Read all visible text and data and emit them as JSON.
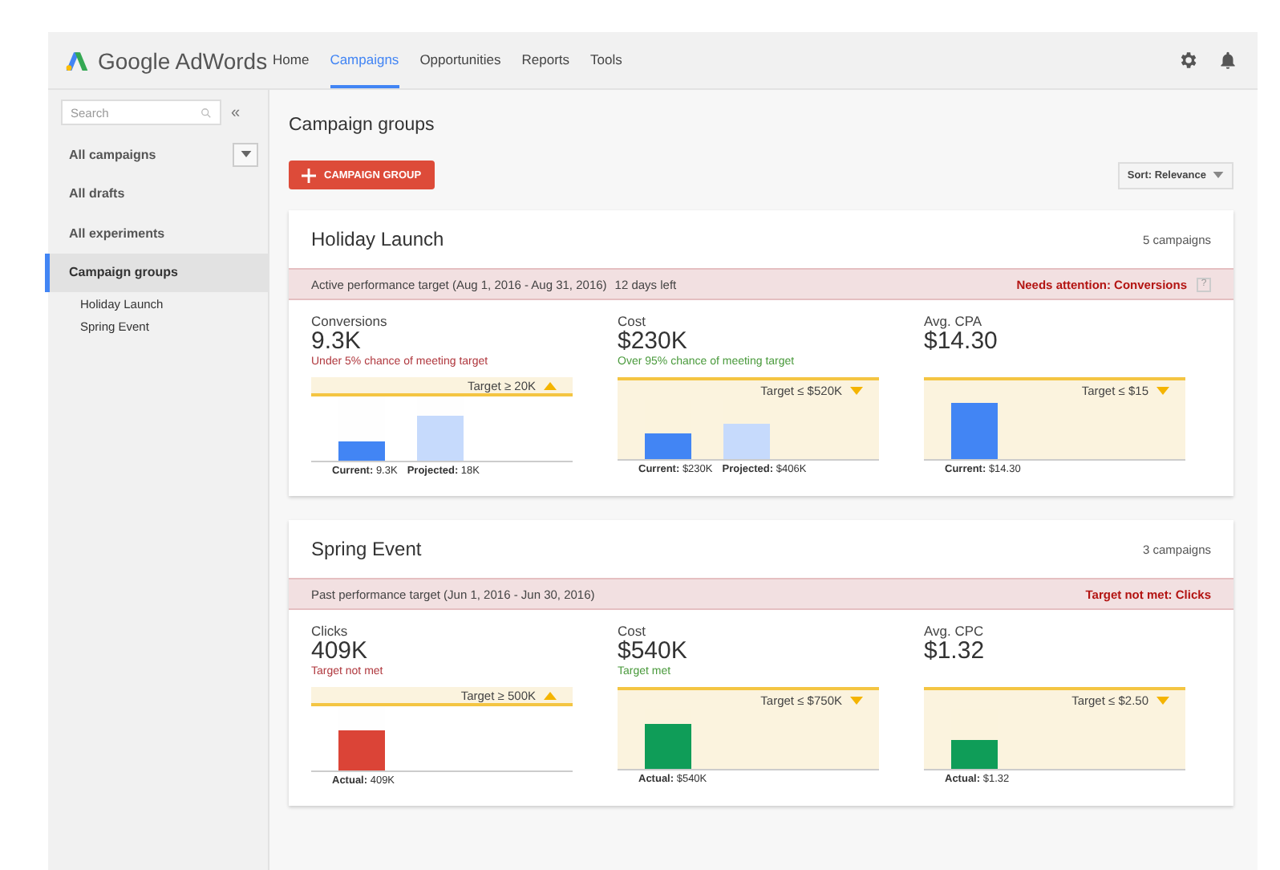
{
  "header": {
    "logo": "Google AdWords",
    "nav": [
      {
        "label": "Home",
        "selected": false
      },
      {
        "label": "Campaigns",
        "selected": true
      },
      {
        "label": "Opportunities",
        "selected": false
      },
      {
        "label": "Reports",
        "selected": false
      },
      {
        "label": "Tools",
        "selected": false
      }
    ]
  },
  "sidebar": {
    "search": {
      "placeholder": "Search"
    },
    "collapse": "«",
    "items": [
      {
        "label": "All campaigns",
        "selected": false,
        "dropdown": true
      },
      {
        "label": "All drafts",
        "selected": false,
        "dropdown": false
      },
      {
        "label": "All experiments",
        "selected": false,
        "dropdown": false
      },
      {
        "label": "Campaign groups",
        "selected": true,
        "dropdown": false,
        "children": [
          {
            "label": "Holiday Launch"
          },
          {
            "label": "Spring Event"
          }
        ]
      }
    ]
  },
  "page": {
    "title": "Campaign groups",
    "add_button": "CAMPAIGN GROUP",
    "sort": "Sort: Relevance"
  },
  "groups": [
    {
      "name": "Holiday Launch",
      "count": "5 campaigns",
      "target": "Active performance target (Aug 1, 2016 - Aug 31, 2016)",
      "remaining": "12 days left",
      "alert": "Needs attention: Conversions",
      "help": "?",
      "metrics": [
        {
          "label": "Conversions",
          "value": "9.3K",
          "status": "Under 5% chance of meeting target",
          "on_track": false,
          "kind": "min",
          "target": "Target ≥ 20K",
          "bars": [
            {
              "level": 0.3,
              "color": "#4285f4",
              "label": "**Current:** 9.3K"
            },
            {
              "level": 0.7,
              "color": "#c6dafc",
              "label": "**Projected:** 18K"
            }
          ]
        },
        {
          "label": "Cost",
          "value": "$230K",
          "status": "Over 95% chance of meeting target",
          "on_track": true,
          "kind": "max",
          "target": "Target ≤ $520K",
          "bars": [
            {
              "level": 0.42,
              "color": "#4285f4",
              "label": "**Current:** $230K"
            },
            {
              "level": 0.6,
              "color": "#c6dafc",
              "label": "**Projected:** $406K"
            }
          ]
        },
        {
          "label": "Avg. CPA",
          "value": "$14.30",
          "kind": "max",
          "target": "Target ≤ $15",
          "bars": [
            {
              "level": 0.95,
              "color": "#4285f4",
              "label": "**Current:** $14.30"
            }
          ]
        }
      ]
    },
    {
      "name": "Spring Event",
      "count": "3 campaigns",
      "target": "Past performance target (Jun 1, 2016 - Jun 30, 2016)",
      "alert": "Target not met: Clicks",
      "metrics": [
        {
          "label": "Clicks",
          "value": "409K",
          "status": "Target not met",
          "on_track": false,
          "kind": "min",
          "target": "Target ≥ 500K",
          "bars": [
            {
              "level": 0.62,
              "color": "#db4437",
              "label": "**Actual:** 409K"
            }
          ]
        },
        {
          "label": "Cost",
          "value": "$540K",
          "status": "Target met",
          "on_track": true,
          "kind": "max",
          "target": "Target ≤ $750K",
          "bars": [
            {
              "level": 0.75,
              "color": "#0f9d58",
              "label": "**Actual:** $540K"
            }
          ]
        },
        {
          "label": "Avg. CPC",
          "value": "$1.32",
          "kind": "max",
          "target": "Target ≤ $2.50",
          "bars": [
            {
              "level": 0.48,
              "color": "#0f9d58",
              "label": "**Actual:** $1.32"
            }
          ]
        }
      ]
    }
  ]
}
